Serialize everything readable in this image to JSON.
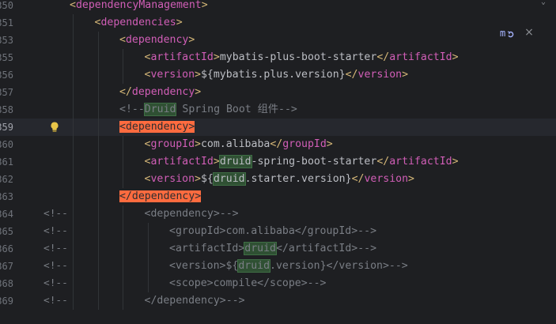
{
  "editor": {
    "language": "xml",
    "current_line": "359",
    "reload_tooltip_icon": "maven-reload-icon",
    "close_icon": "×",
    "lines": [
      {
        "num": "350",
        "comment_marker": "",
        "tokens": [
          {
            "k": "bracket",
            "t": "<"
          },
          {
            "k": "tagname",
            "t": "dependencyManagement"
          },
          {
            "k": "bracket",
            "t": ">"
          }
        ],
        "indent": 1
      },
      {
        "num": "351",
        "comment_marker": "",
        "tokens": [
          {
            "k": "bracket",
            "t": "<"
          },
          {
            "k": "tagname",
            "t": "dependencies"
          },
          {
            "k": "bracket",
            "t": ">"
          }
        ],
        "indent": 2
      },
      {
        "num": "353",
        "comment_marker": "",
        "tokens": [
          {
            "k": "bracket",
            "t": "<"
          },
          {
            "k": "tagname",
            "t": "dependency"
          },
          {
            "k": "bracket",
            "t": ">"
          }
        ],
        "indent": 3
      },
      {
        "num": "355",
        "comment_marker": "",
        "tokens": [
          {
            "k": "bracket",
            "t": "<"
          },
          {
            "k": "tagname",
            "t": "artifactId"
          },
          {
            "k": "bracket",
            "t": ">"
          },
          {
            "k": "text",
            "t": "mybatis-plus-boot-starter"
          },
          {
            "k": "bracket",
            "t": "</"
          },
          {
            "k": "tagname",
            "t": "artifactId"
          },
          {
            "k": "bracket",
            "t": ">"
          }
        ],
        "indent": 4
      },
      {
        "num": "356",
        "comment_marker": "",
        "tokens": [
          {
            "k": "bracket",
            "t": "<"
          },
          {
            "k": "tagname",
            "t": "version"
          },
          {
            "k": "bracket",
            "t": ">"
          },
          {
            "k": "text",
            "t": "${mybatis.plus.version}"
          },
          {
            "k": "bracket",
            "t": "</"
          },
          {
            "k": "tagname",
            "t": "version"
          },
          {
            "k": "bracket",
            "t": ">"
          }
        ],
        "indent": 4
      },
      {
        "num": "357",
        "comment_marker": "",
        "tokens": [
          {
            "k": "bracket",
            "t": "</"
          },
          {
            "k": "tagname",
            "t": "dependency"
          },
          {
            "k": "bracket",
            "t": ">"
          }
        ],
        "indent": 3
      },
      {
        "num": "358",
        "comment_marker": "",
        "tokens": [
          {
            "k": "comment",
            "t": "<!--"
          },
          {
            "k": "comment-hl",
            "t": "Druid"
          },
          {
            "k": "comment",
            "t": " Spring Boot 组件-->"
          }
        ],
        "indent": 3
      },
      {
        "num": "359",
        "comment_marker": "",
        "current": true,
        "bulb": true,
        "tokens": [
          {
            "k": "tag-hl",
            "t": "<dependency>"
          }
        ],
        "indent": 3
      },
      {
        "num": "360",
        "comment_marker": "",
        "tokens": [
          {
            "k": "bracket",
            "t": "<"
          },
          {
            "k": "tagname",
            "t": "groupId"
          },
          {
            "k": "bracket",
            "t": ">"
          },
          {
            "k": "text",
            "t": "com.alibaba"
          },
          {
            "k": "bracket",
            "t": "</"
          },
          {
            "k": "tagname",
            "t": "groupId"
          },
          {
            "k": "bracket",
            "t": ">"
          }
        ],
        "indent": 4
      },
      {
        "num": "361",
        "comment_marker": "",
        "tokens": [
          {
            "k": "bracket",
            "t": "<"
          },
          {
            "k": "tagname",
            "t": "artifactId"
          },
          {
            "k": "bracket",
            "t": ">"
          },
          {
            "k": "text-hl",
            "t": "druid"
          },
          {
            "k": "text",
            "t": "-spring-boot-starter"
          },
          {
            "k": "bracket",
            "t": "</"
          },
          {
            "k": "tagname",
            "t": "artifactId"
          },
          {
            "k": "bracket",
            "t": ">"
          }
        ],
        "indent": 4
      },
      {
        "num": "362",
        "comment_marker": "",
        "tokens": [
          {
            "k": "bracket",
            "t": "<"
          },
          {
            "k": "tagname",
            "t": "version"
          },
          {
            "k": "bracket",
            "t": ">"
          },
          {
            "k": "text",
            "t": "${"
          },
          {
            "k": "text-hl",
            "t": "druid"
          },
          {
            "k": "text",
            "t": ".starter.version}"
          },
          {
            "k": "bracket",
            "t": "</"
          },
          {
            "k": "tagname",
            "t": "version"
          },
          {
            "k": "bracket",
            "t": ">"
          }
        ],
        "indent": 4
      },
      {
        "num": "363",
        "comment_marker": "",
        "tokens": [
          {
            "k": "tag-hl",
            "t": "</dependency>"
          }
        ],
        "indent": 3
      },
      {
        "num": "364",
        "comment_marker": "<!--",
        "tokens": [
          {
            "k": "comment",
            "t": "<dependency>-->"
          }
        ],
        "indent": 4
      },
      {
        "num": "365",
        "comment_marker": "<!--",
        "tokens": [
          {
            "k": "comment",
            "t": "<groupId>com.alibaba</groupId>-->"
          }
        ],
        "indent": 5
      },
      {
        "num": "366",
        "comment_marker": "<!--",
        "tokens": [
          {
            "k": "comment",
            "t": "<artifactId>"
          },
          {
            "k": "comment-hl",
            "t": "druid"
          },
          {
            "k": "comment",
            "t": "</artifactId>-->"
          }
        ],
        "indent": 5
      },
      {
        "num": "367",
        "comment_marker": "<!--",
        "tokens": [
          {
            "k": "comment",
            "t": "<version>${"
          },
          {
            "k": "comment-hl",
            "t": "druid"
          },
          {
            "k": "comment",
            "t": ".version}</version>-->"
          }
        ],
        "indent": 5
      },
      {
        "num": "368",
        "comment_marker": "<!--",
        "tokens": [
          {
            "k": "comment",
            "t": "<scope>compile</scope>-->"
          }
        ],
        "indent": 5
      },
      {
        "num": "369",
        "comment_marker": "<!--",
        "tokens": [
          {
            "k": "comment",
            "t": "</dependency>-->"
          }
        ],
        "indent": 4
      }
    ]
  },
  "colors": {
    "background": "#1e1f22",
    "tag_name": "#d15eb7",
    "tag_bracket": "#d5b778",
    "text": "#bcbec4",
    "comment": "#7a7e85",
    "tag_highlight": "#ff6b3f",
    "word_highlight": "#2f5033"
  }
}
